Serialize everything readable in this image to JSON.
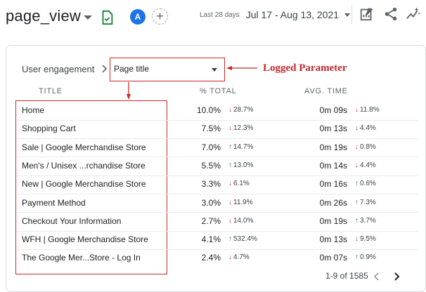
{
  "header": {
    "event_name": "page_view",
    "comparison_avatar": "A",
    "date_label": "Last 28 days",
    "date_range": "Jul 17 - Aug 13, 2021",
    "icons": [
      "caret-down-icon",
      "check-file-icon",
      "add-comparison-icon",
      "edit-chart-icon",
      "share-icon",
      "insights-icon"
    ]
  },
  "card": {
    "breadcrumb_root": "User engagement",
    "dimension_select": "Page title",
    "annotation": "Logged Parameter"
  },
  "table": {
    "headers": {
      "title": "TITLE",
      "total": "% TOTAL",
      "time": "AVG. TIME"
    },
    "rows": [
      {
        "title": "Home",
        "total": "10.0%",
        "total_dir": "down",
        "total_delta": "28.7%",
        "time": "0m 09s",
        "time_dir": "down",
        "time_delta": "11.8%"
      },
      {
        "title": "Shopping Cart",
        "total": "7.5%",
        "total_dir": "down",
        "total_delta": "12.3%",
        "time": "0m 13s",
        "time_dir": "down",
        "time_delta": "4.4%"
      },
      {
        "title": "Sale | Google Merchandise Store",
        "total": "7.0%",
        "total_dir": "up",
        "total_delta": "14.7%",
        "time": "0m 19s",
        "time_dir": "down",
        "time_delta": "0.8%"
      },
      {
        "title": "Men's / Unisex ...rchandise Store",
        "total": "5.5%",
        "total_dir": "up",
        "total_delta": "13.0%",
        "time": "0m 14s",
        "time_dir": "down",
        "time_delta": "4.4%"
      },
      {
        "title": "New | Google Merchandise Store",
        "total": "3.3%",
        "total_dir": "down",
        "total_delta": "6.1%",
        "time": "0m 16s",
        "time_dir": "up",
        "time_delta": "0.6%"
      },
      {
        "title": "Payment Method",
        "total": "3.0%",
        "total_dir": "down",
        "total_delta": "11.9%",
        "time": "0m 26s",
        "time_dir": "up",
        "time_delta": "7.3%"
      },
      {
        "title": "Checkout Your Information",
        "total": "2.7%",
        "total_dir": "down",
        "total_delta": "14.0%",
        "time": "0m 19s",
        "time_dir": "up",
        "time_delta": "3.7%"
      },
      {
        "title": "WFH | Google Merchandise Store",
        "total": "4.1%",
        "total_dir": "up",
        "total_delta": "532.4%",
        "time": "0m 13s",
        "time_dir": "down",
        "time_delta": "9.5%"
      },
      {
        "title": "The Google Mer...Store - Log In",
        "total": "2.4%",
        "total_dir": "down",
        "total_delta": "4.7%",
        "time": "0m 07s",
        "time_dir": "up",
        "time_delta": "0.9%"
      }
    ]
  },
  "pagination": {
    "label": "1-9 of 1585"
  },
  "colors": {
    "accent": "#1a73e8",
    "annotation": "#c62828",
    "down": "#d93025",
    "up": "#188038"
  }
}
